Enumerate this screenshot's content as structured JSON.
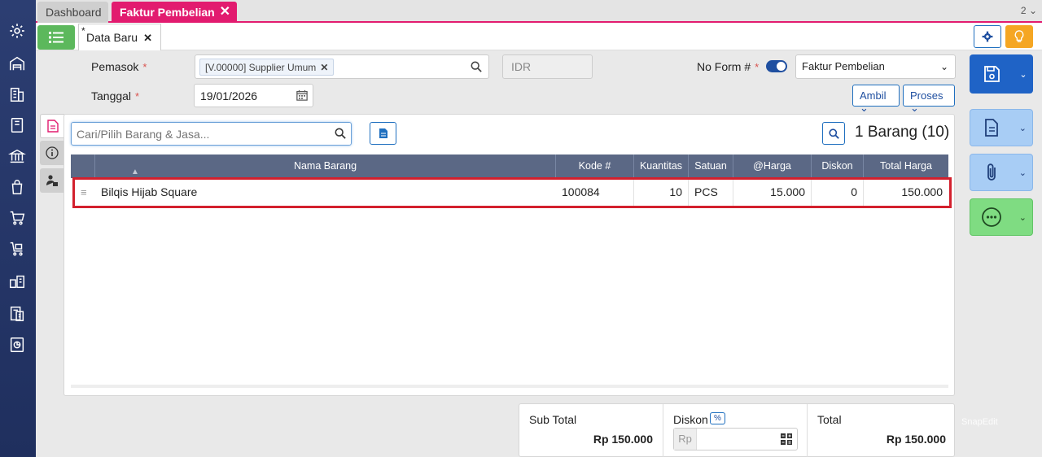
{
  "tabs": {
    "dashboard": "Dashboard",
    "faktur": "Faktur Pembelian",
    "count": "2"
  },
  "doc_tab": {
    "star": "*",
    "label": "Data Baru"
  },
  "form": {
    "supplier_label": "Pemasok",
    "required_mark": "*",
    "supplier_value": "[V.00000] Supplier Umum",
    "currency": "IDR",
    "form_no_label": "No Form #",
    "form_type": "Faktur Pembelian",
    "date_label": "Tanggal",
    "date_value": "19/01/2026",
    "ambil_label": "Ambil",
    "proses_label": "Proses"
  },
  "items": {
    "search_placeholder": "Cari/Pilih Barang & Jasa...",
    "count_label": "1 Barang (10)",
    "headers": {
      "name": "Nama Barang",
      "code": "Kode #",
      "qty": "Kuantitas",
      "unit": "Satuan",
      "price": "@Harga",
      "discount": "Diskon",
      "total": "Total Harga"
    },
    "rows": [
      {
        "name": "Bilqis Hijab Square",
        "code": "100084",
        "qty": "10",
        "unit": "PCS",
        "price": "15.000",
        "discount": "0",
        "total": "150.000"
      }
    ]
  },
  "totals": {
    "subtotal_label": "Sub Total",
    "subtotal_value": "Rp 150.000",
    "discount_label": "Diskon",
    "discount_pct": "%",
    "discount_prefix": "Rp",
    "total_label": "Total",
    "total_value": "Rp 150.000"
  },
  "watermark": "SnapEdit",
  "colors": {
    "accent_pink": "#e21b6f",
    "primary_blue": "#1f63c6",
    "sidebar": "#2c3e72",
    "highlight_red": "#d3202d",
    "success_green": "#5cb85c"
  },
  "icons": {
    "sidebar": [
      "settings-icon",
      "warehouse-icon",
      "building-icon",
      "book-icon",
      "bank-icon",
      "sales-icon",
      "cart-icon",
      "purchase-cart-icon",
      "inventory-icon",
      "tax-icon",
      "report-icon"
    ]
  }
}
